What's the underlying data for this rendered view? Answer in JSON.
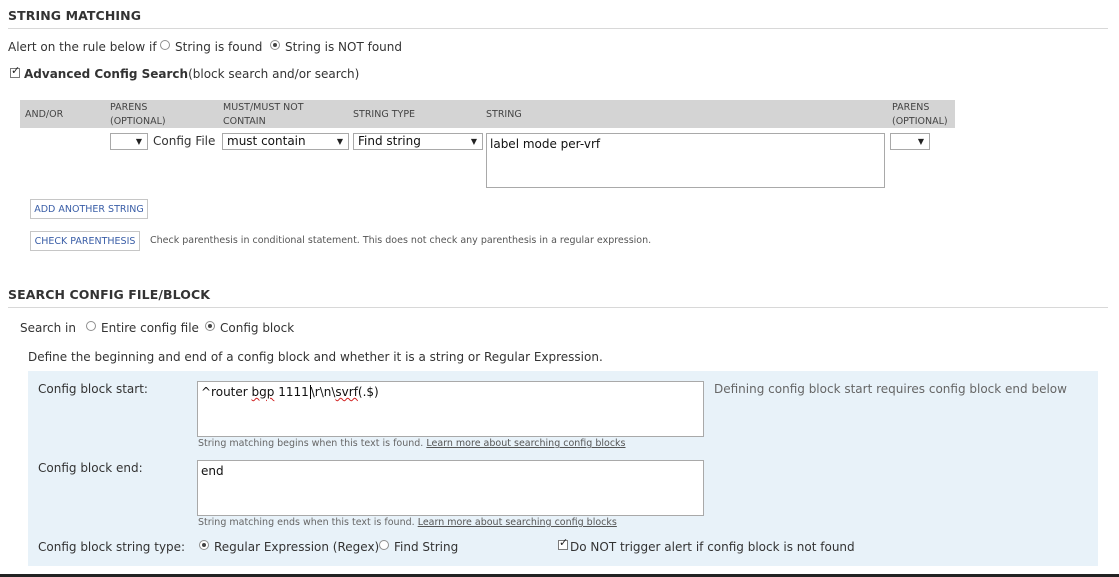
{
  "string_matching": {
    "title": "STRING MATCHING",
    "alert_label": "Alert on the rule below if",
    "opt_found": "String is found",
    "opt_not_found": "String is NOT found",
    "advanced_label": "Advanced Config Search",
    "advanced_note": "(block search and/or search)",
    "table": {
      "col_andor": "AND/OR",
      "col_parens1_a": "PARENS",
      "col_parens1_b": "(OPTIONAL)",
      "col_must_a": "MUST/MUST NOT",
      "col_must_b": "CONTAIN",
      "col_type": "STRING TYPE",
      "col_string": "STRING",
      "col_parens2_a": "PARENS",
      "col_parens2_b": "(OPTIONAL)",
      "row_config_file": "Config File",
      "must_value": "must contain",
      "type_value": "Find string",
      "string_value": "label mode per-vrf"
    },
    "add_button": "ADD ANOTHER STRING",
    "check_button": "CHECK PARENTHESIS",
    "check_note": "Check parenthesis in conditional statement. This does not check any parenthesis in a regular expression."
  },
  "search_config": {
    "title": "SEARCH CONFIG FILE/BLOCK",
    "search_in_label": "Search in",
    "opt_entire": "Entire config file",
    "opt_block": "Config block",
    "define_text": "Define the beginning and end of a config block and whether it is a string or Regular Expression.",
    "start_label": "Config block start:",
    "start_value": {
      "p1": "^router ",
      "p2": "bgp",
      "p3": " 1111",
      "p4": "\\r\\n\\",
      "p5": "svrf",
      "p6": "(.$)"
    },
    "start_note": "Defining config block start requires config block end below",
    "start_hint": "String matching begins when this text is found.",
    "start_link": "Learn more about searching config blocks",
    "end_label": "Config block end:",
    "end_value": "end",
    "end_hint": "String matching ends when this text is found.",
    "end_link": "Learn more about searching config blocks",
    "type_label": "Config block string type:",
    "opt_regex": "Regular Expression (Regex)",
    "opt_find": "Find String",
    "no_trigger_label": "Do NOT trigger alert if config block is not found"
  }
}
